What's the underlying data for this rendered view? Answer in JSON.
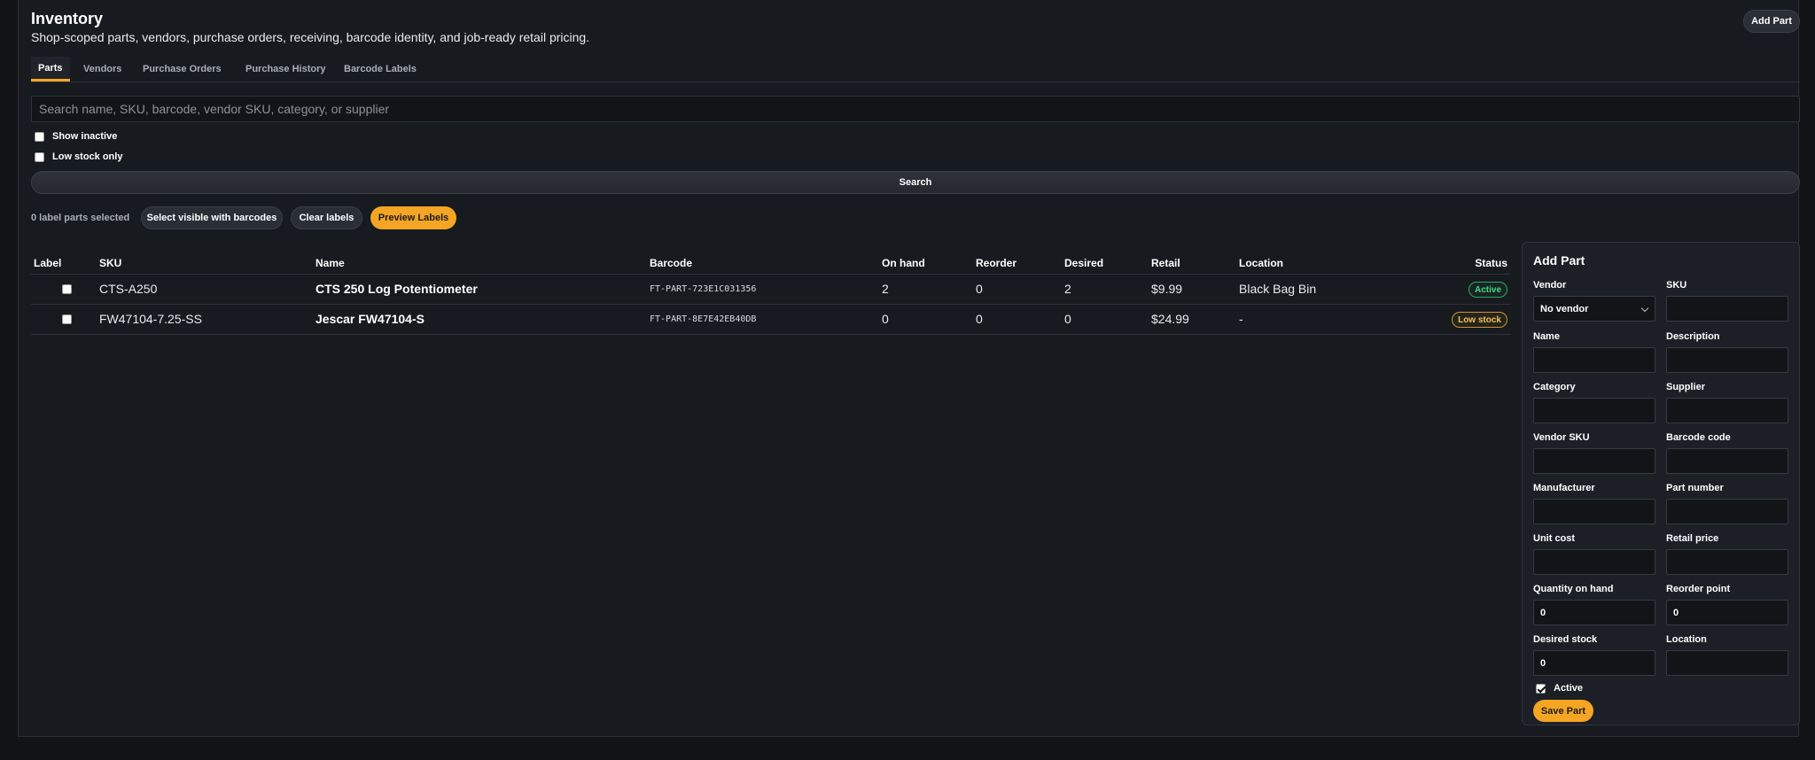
{
  "header": {
    "title": "Inventory",
    "subtitle": "Shop-scoped parts, vendors, purchase orders, receiving, barcode identity, and job-ready retail pricing.",
    "add_part_label": "Add Part"
  },
  "tabs": [
    {
      "label": "Parts",
      "active": true
    },
    {
      "label": "Vendors",
      "active": false
    },
    {
      "label": "Purchase Orders",
      "active": false
    },
    {
      "label": "Purchase History",
      "active": false
    },
    {
      "label": "Barcode Labels",
      "active": false
    }
  ],
  "search": {
    "placeholder": "Search name, SKU, barcode, vendor SKU, category, or supplier",
    "value": "",
    "button_label": "Search"
  },
  "filters": {
    "show_inactive": {
      "label": "Show inactive",
      "checked": false
    },
    "low_stock_only": {
      "label": "Low stock only",
      "checked": false
    }
  },
  "labels_bar": {
    "selected_text": "0 label parts selected",
    "select_visible_label": "Select visible with barcodes",
    "clear_label": "Clear labels",
    "preview_label": "Preview Labels"
  },
  "table": {
    "columns": [
      "Label",
      "SKU",
      "Name",
      "Barcode",
      "On hand",
      "Reorder",
      "Desired",
      "Retail",
      "Location",
      "Status"
    ],
    "rows": [
      {
        "sku": "CTS-A250",
        "name": "CTS 250 Log Potentiometer",
        "barcode": "FT-PART-723E1C031356",
        "on_hand": "2",
        "reorder": "0",
        "desired": "2",
        "retail": "$9.99",
        "location": "Black Bag Bin",
        "status": "Active"
      },
      {
        "sku": "FW47104-7.25-SS",
        "name": "Jescar FW47104-S",
        "barcode": "FT-PART-8E7E42EB40DB",
        "on_hand": "0",
        "reorder": "0",
        "desired": "0",
        "retail": "$24.99",
        "location": "-",
        "status": "Low stock"
      }
    ]
  },
  "form": {
    "title": "Add Part",
    "vendor_label": "Vendor",
    "vendor_value": "No vendor",
    "sku_label": "SKU",
    "name_label": "Name",
    "description_label": "Description",
    "category_label": "Category",
    "supplier_label": "Supplier",
    "vendor_sku_label": "Vendor SKU",
    "barcode_code_label": "Barcode code",
    "manufacturer_label": "Manufacturer",
    "part_number_label": "Part number",
    "unit_cost_label": "Unit cost",
    "retail_price_label": "Retail price",
    "qty_label": "Quantity on hand",
    "qty_value": "0",
    "reorder_label": "Reorder point",
    "reorder_value": "0",
    "desired_label": "Desired stock",
    "desired_value": "0",
    "location_label": "Location",
    "active_label": "Active",
    "active_checked": true,
    "save_label": "Save Part"
  },
  "colors": {
    "accent": "#f5a524",
    "background": "#111317",
    "status_active": "#3ddc84",
    "status_low": "#f5c04a"
  }
}
